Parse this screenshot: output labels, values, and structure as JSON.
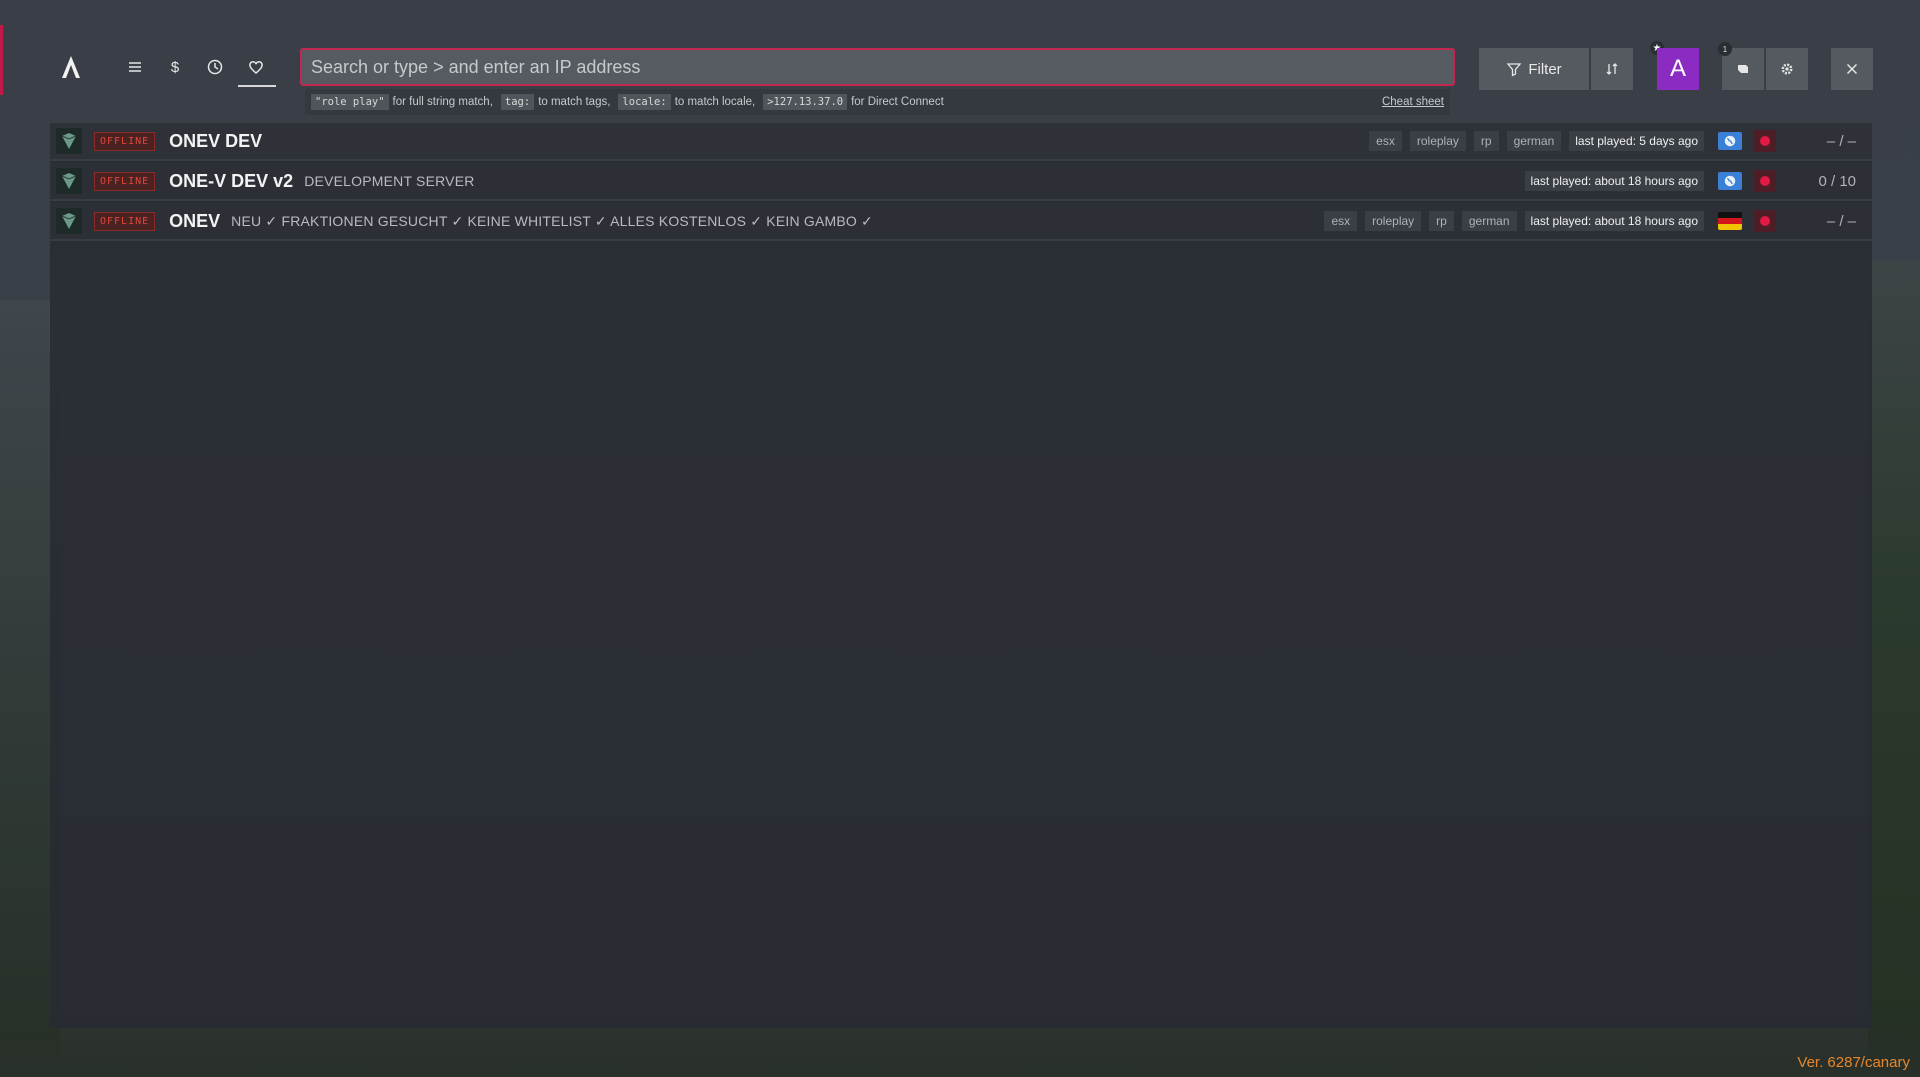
{
  "search": {
    "placeholder": "Search or type > and enter an IP address"
  },
  "hints": [
    {
      "code": "\"role play\"",
      "text": "for full string match,"
    },
    {
      "code": "tag:",
      "text": "to match tags,"
    },
    {
      "code": "locale:",
      "text": "to match locale,"
    },
    {
      "code": ">127.13.37.0",
      "text": "for Direct Connect"
    }
  ],
  "cheat_sheet": "Cheat sheet",
  "toolbar": {
    "filter_label": "Filter",
    "avatar_letter": "A",
    "notif_count": "1"
  },
  "servers": [
    {
      "status": "OFFLINE",
      "name": "ONEV DEV",
      "description": "",
      "tags": [
        "esx",
        "roleplay",
        "rp",
        "german"
      ],
      "last_played": "last played: 5 days ago",
      "locale_icon": "globe-icon",
      "players": "– / –"
    },
    {
      "status": "OFFLINE",
      "name": "ONE-V DEV v2",
      "description": "DEVELOPMENT SERVER",
      "tags": [],
      "last_played": "last played: about 18 hours ago",
      "locale_icon": "globe-icon",
      "players": "0 / 10"
    },
    {
      "status": "OFFLINE",
      "name": "ONEV",
      "description": "NEU ✓ FRAKTIONEN GESUCHT ✓ KEINE WHITELIST ✓ ALLES KOSTENLOS ✓ KEIN GAMBO ✓",
      "tags": [
        "esx",
        "roleplay",
        "rp",
        "german"
      ],
      "last_played": "last played: about 18 hours ago",
      "locale_icon": "flag-de-icon",
      "players": "– / –"
    }
  ],
  "version": "Ver. 6287/canary",
  "colors": {
    "accent": "#c2274f",
    "avatar": "#8c2bc2",
    "offline": "#e2463b",
    "version": "#e8872a"
  }
}
